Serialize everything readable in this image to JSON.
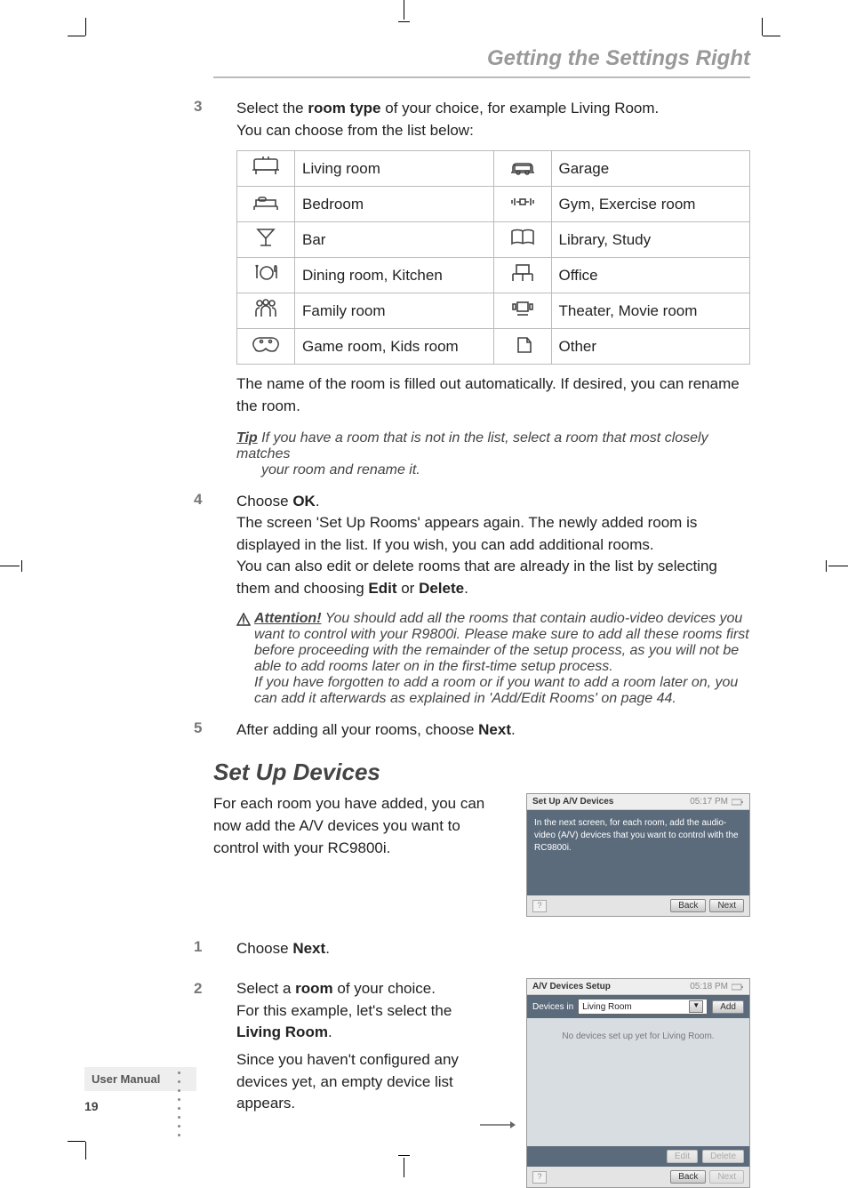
{
  "header": {
    "title": "Getting the Settings Right"
  },
  "step3": {
    "num": "3",
    "line1_a": "Select the ",
    "line1_b": "room type",
    "line1_c": " of your choice, for example Living Room.",
    "line2": "You can choose from the list below:"
  },
  "rooms": {
    "left": [
      {
        "label": "Living room"
      },
      {
        "label": "Bedroom"
      },
      {
        "label": "Bar"
      },
      {
        "label": "Dining room, Kitchen"
      },
      {
        "label": "Family room"
      },
      {
        "label": "Game room, Kids room"
      }
    ],
    "right": [
      {
        "label": "Garage"
      },
      {
        "label": "Gym, Exercise room"
      },
      {
        "label": "Library, Study"
      },
      {
        "label": "Office"
      },
      {
        "label": "Theater, Movie room"
      },
      {
        "label": "Other"
      }
    ]
  },
  "note_after_table": "The name of the room is filled out automatically. If desired, you can rename the room.",
  "tip": {
    "label": "Tip",
    "line1": " If you have a room that is not in the list, select a room that most closely matches",
    "line2": "your room and rename it."
  },
  "step4": {
    "num": "4",
    "line1_a": "Choose ",
    "line1_b": "OK",
    "line1_c": ".",
    "p1": "The screen 'Set Up Rooms' appears again. The newly added room is displayed in the list. If you wish, you can add additional rooms.",
    "p2_a": "You can also edit or delete rooms that are already in the list by selecting them and choosing ",
    "p2_b": "Edit",
    "p2_c": " or ",
    "p2_d": "Delete",
    "p2_e": "."
  },
  "attention": {
    "label": "Attention!",
    "body1": " You should add all the rooms that contain audio-video devices you want to control with your R9800i. Please make sure to add all these rooms first before proceeding with the remainder of the setup process, as you will not be able to add rooms later on in the first-time setup process.",
    "body2": "If you have forgotten to add a room or if you want to add a room later on, you can add it afterwards as explained in 'Add/Edit Rooms' on page 44."
  },
  "step5": {
    "num": "5",
    "a": "After adding all your rooms, choose ",
    "b": "Next",
    "c": "."
  },
  "section2": {
    "title": "Set Up Devices"
  },
  "devices_intro": "For each room you have added, you can now add the A/V devices you want to control with your RC9800i.",
  "screen1": {
    "title": "Set Up A/V Devices",
    "clock": "05:17 PM",
    "body": "In the next screen, for each room, add the audio-video (A/V) devices that you want to control with the RC9800i.",
    "help": "?",
    "back": "Back",
    "next": "Next"
  },
  "step_d1": {
    "num": "1",
    "a": "Choose ",
    "b": "Next",
    "c": "."
  },
  "step_d2": {
    "num": "2",
    "a": "Select a ",
    "b": "room",
    "c": " of your choice.",
    "d": "For this example, let's select the ",
    "e": "Living Room",
    "f": ".",
    "g": "Since you haven't configured any devices yet, an empty device list appears."
  },
  "screen2": {
    "title": "A/V Devices Setup",
    "clock": "05:18 PM",
    "bar_label": "Devices in",
    "room": "Living Room",
    "add": "Add",
    "empty": "No devices set up yet for Living Room.",
    "edit": "Edit",
    "delete": "Delete",
    "help": "?",
    "back": "Back",
    "next": "Next"
  },
  "footer": {
    "label": "User Manual",
    "page": "19"
  }
}
